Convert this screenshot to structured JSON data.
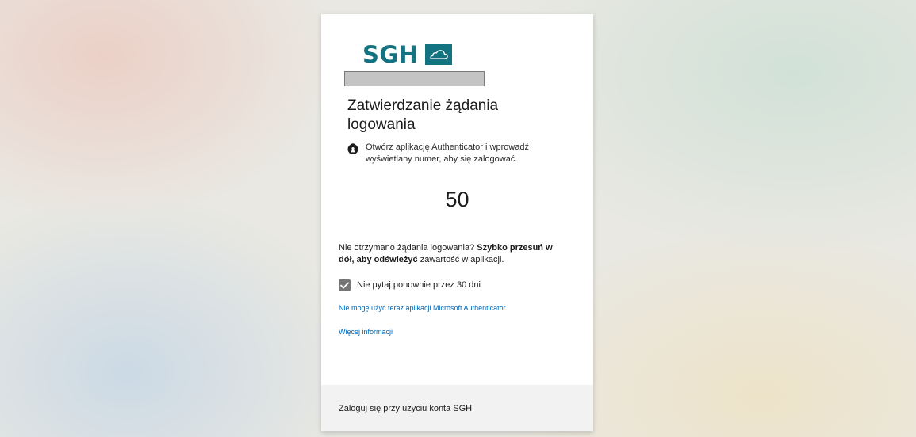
{
  "brand": {
    "logo_text": "SGH",
    "color": "#137380"
  },
  "account_field": {
    "value": ""
  },
  "title": "Zatwierdzanie żądania logowania",
  "instruction": {
    "icon": "lock-person-icon",
    "text": "Otwórz aplikację Authenticator i wprowadź wyświetlany numer, aby się zalogować."
  },
  "display_number": "50",
  "not_received": {
    "prefix": "Nie otrzymano żądania logowania? ",
    "bold": "Szybko przesuń w dół, aby odświeżyć",
    "suffix": " zawartość w aplikacji."
  },
  "remember": {
    "checked": true,
    "label": "Nie pytaj ponownie przez 30 dni"
  },
  "links": {
    "cannot_use": "Nie mogę użyć teraz aplikacji Microsoft Authenticator",
    "more_info": "Więcej informacji"
  },
  "footer": {
    "text": "Zaloguj się przy użyciu konta SGH"
  },
  "colors": {
    "link": "#0067b8",
    "checkbox": "#767676",
    "footer_bg": "#f2f2f2"
  }
}
